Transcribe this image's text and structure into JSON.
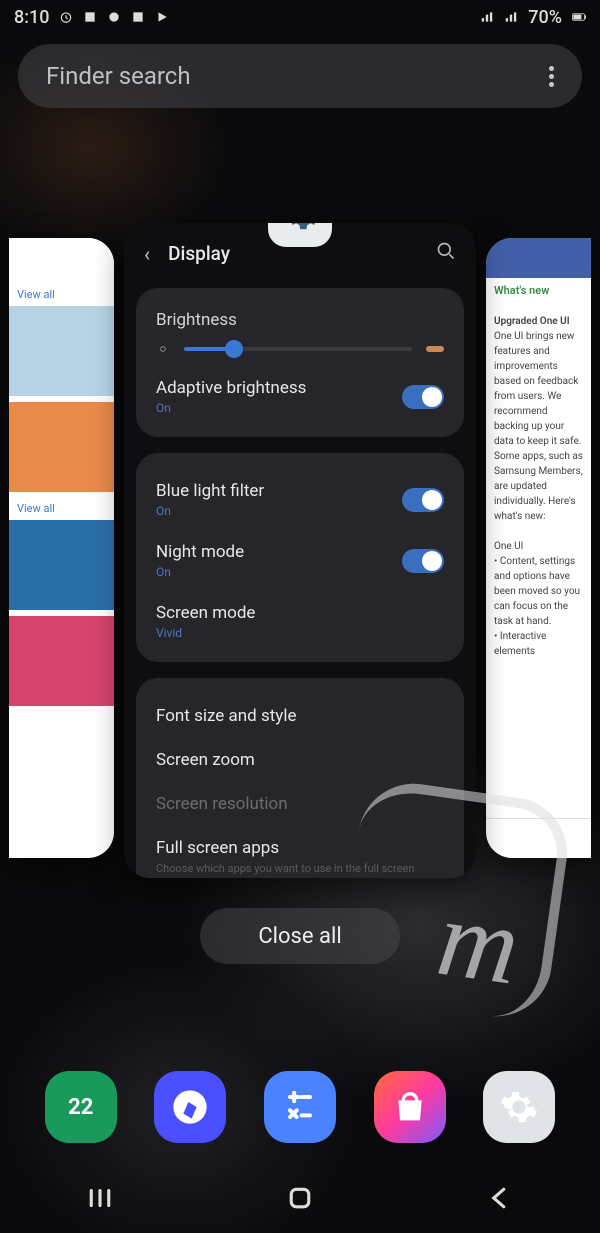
{
  "statusbar": {
    "time": "8:10",
    "battery": "70%"
  },
  "search": {
    "placeholder": "Finder search"
  },
  "center_card": {
    "app_name": "Settings",
    "title": "Display",
    "brightness_label": "Brightness",
    "adaptive_label": "Adaptive brightness",
    "adaptive_sub": "On",
    "bluelight_label": "Blue light filter",
    "bluelight_sub": "On",
    "night_label": "Night mode",
    "night_sub": "On",
    "screenmode_label": "Screen mode",
    "screenmode_sub": "Vivid",
    "font_label": "Font size and style",
    "zoom_label": "Screen zoom",
    "resolution_label": "Screen resolution",
    "fullscreen_label": "Full screen apps",
    "fullscreen_note": "Choose which apps you want to use in the full screen aspect ratio."
  },
  "right_card": {
    "heading": "What's new",
    "sub": "Upgraded One UI"
  },
  "close_all": "Close all",
  "dock": {
    "calendar_day": "22"
  }
}
